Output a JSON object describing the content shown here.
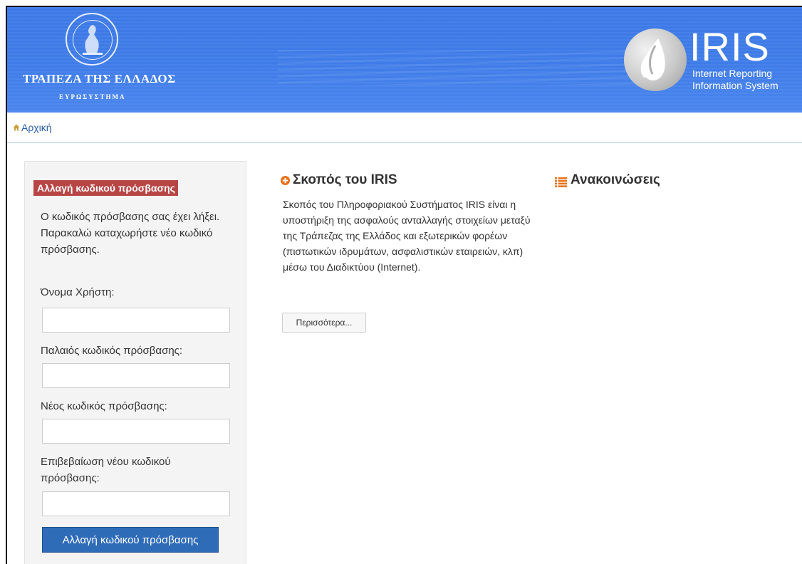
{
  "header": {
    "bank_name": "ΤΡΑΠΕΖΑ ΤΗΣ ΕΛΛΑΔΟΣ",
    "bank_subtitle": "ΕΥΡΩΣΥΣΤΗΜΑ",
    "system_name": "IRIS",
    "system_subtitle_line1": "Internet Reporting",
    "system_subtitle_line2": "Information System",
    "bank_seal_icon": "bank-of-greece-seal-icon",
    "iris_logo_icon": "iris-drop-logo-icon",
    "color": "#3f7ce8"
  },
  "breadcrumb": {
    "home_label": "Αρχική",
    "home_icon": "home-icon"
  },
  "change_password": {
    "title": "Αλλαγή κωδικού πρόσβασης",
    "message": "Ο κωδικός πρόσβασης σας έχει λήξει. Παρακαλώ καταχωρήστε νέο κωδικό πρόσβασης.",
    "username_label": "Όνομα Χρήστη:",
    "username_value": "",
    "old_password_label": "Παλαιός κωδικός πρόσβασης:",
    "old_password_value": "",
    "new_password_label": "Νέος κωδικός πρόσβασης:",
    "new_password_value": "",
    "confirm_password_label": "Επιβεβαίωση νέου κωδικού πρόσβασης:",
    "confirm_password_value": "",
    "submit_label": "Αλλαγή κωδικού πρόσβασης",
    "title_color": "#b84545",
    "button_color": "#2f6cb8"
  },
  "purpose": {
    "title": "Σκοπός του IRIS",
    "icon": "plus-circle-icon",
    "text": "Σκοπός του Πληροφοριακού Συστήματος IRIS είναι η υποστήριξη της ασφαλούς ανταλλαγής στοιχείων μεταξύ της Τράπεζας της Ελλάδος και εξωτερικών φορέων (πιστωτικών ιδρυμάτων, ασφαλιστικών εταιρειών, κλπ) μέσω του Διαδικτύου (Internet).",
    "more_label": "Περισσότερα...",
    "icon_color": "#e8701a"
  },
  "announcements": {
    "title": "Ανακοινώσεις",
    "icon": "list-icon",
    "icon_color": "#e8701a"
  }
}
